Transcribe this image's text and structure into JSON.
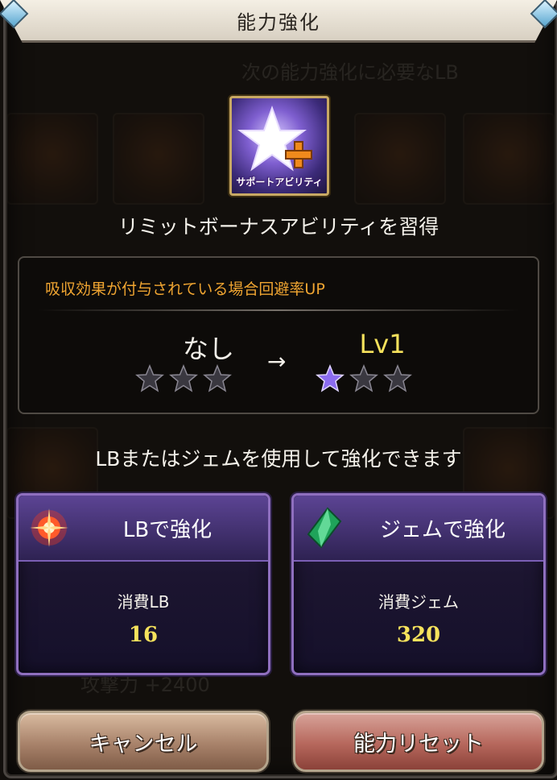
{
  "window": {
    "title": "能力強化"
  },
  "ability": {
    "icon_caption": "サポートアビリティ",
    "heading": "リミットボーナスアビリティを習得"
  },
  "effect": {
    "description": "吸収効果が付与されている場合回避率UP",
    "from_level": "なし",
    "arrow": "→",
    "to_level": "Lv1",
    "from_stars_filled": 0,
    "to_stars_filled": 1,
    "stars_total": 3
  },
  "info_text": "LBまたはジェムを使用して強化できます",
  "options": [
    {
      "icon": "lb-burst-icon",
      "label": "LBで強化",
      "cost_label": "消費LB",
      "cost_value": "16"
    },
    {
      "icon": "green-gem-icon",
      "label": "ジェムで強化",
      "cost_label": "消費ジェム",
      "cost_value": "320"
    }
  ],
  "buttons": {
    "cancel": "キャンセル",
    "reset": "能力リセット"
  },
  "background": {
    "faded_text_1": "次の能力強化に必要なLB",
    "faded_text_2": "攻撃力 +2400"
  },
  "colors": {
    "accent_yellow": "#f6e25c",
    "accent_orange": "#f0a531",
    "card_purple": "#8f6fbf"
  }
}
